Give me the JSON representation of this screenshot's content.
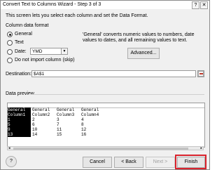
{
  "window": {
    "title": "Convert Text to Columns Wizard - Step 3 of 3",
    "help_glyph": "?",
    "close_glyph": "✕"
  },
  "instructions": "This screen lets you select each column and set the Data Format.",
  "column_format": {
    "label": "Column data format",
    "options": [
      "General",
      "Text",
      "Date:",
      "Do not import column (skip)"
    ],
    "selected": "General",
    "date_value": "YMD",
    "description": "'General' converts numeric values to numbers, date values to dates, and all remaining values to text.",
    "advanced_label": "Advanced..."
  },
  "destination": {
    "label": "Destination:",
    "value": "$A$1"
  },
  "preview": {
    "label": "Data preview",
    "columns": [
      {
        "header": "General",
        "cells": [
          "Column1",
          "1",
          "5",
          "9",
          "13"
        ],
        "selected": true
      },
      {
        "header": "General",
        "cells": [
          "Column2",
          "2",
          "6",
          "10",
          "14"
        ],
        "selected": false
      },
      {
        "header": "General",
        "cells": [
          "Column3",
          "3",
          "7",
          "11",
          "15"
        ],
        "selected": false
      },
      {
        "header": "General",
        "cells": [
          "Column4",
          "4",
          "8",
          "12",
          "16"
        ],
        "selected": false
      }
    ]
  },
  "buttons": {
    "cancel": "Cancel",
    "back": "< Back",
    "next": "Next >",
    "finish": "Finish"
  },
  "colors": {
    "highlight": "#d9232d",
    "selected_column": "#000000"
  }
}
